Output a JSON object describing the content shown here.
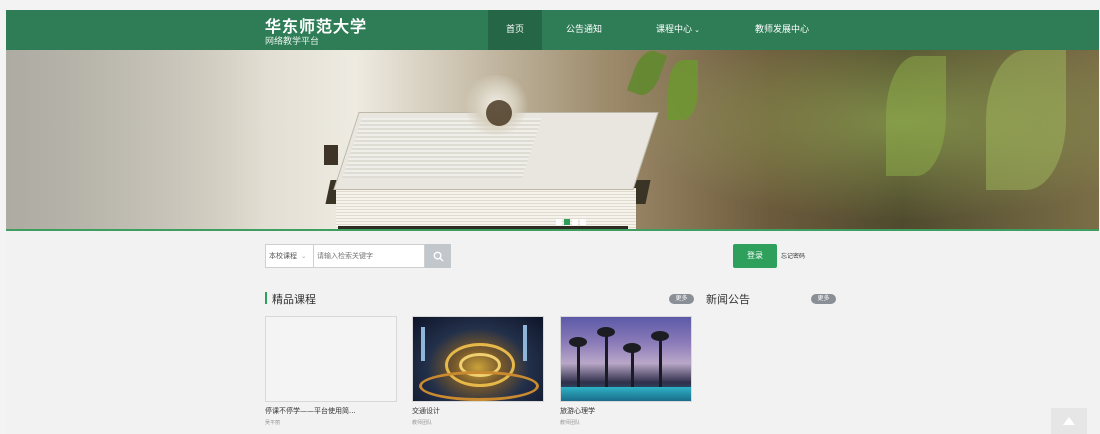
{
  "brand": {
    "title": "华东师范大学",
    "subtitle": "网络教学平台"
  },
  "nav": {
    "items": [
      {
        "label": "首页"
      },
      {
        "label": "公告通知"
      },
      {
        "label": "课程中心"
      },
      {
        "label": "教师发展中心"
      }
    ]
  },
  "search": {
    "scope": "本校课程",
    "placeholder": "请输入检索关键字"
  },
  "login": {
    "button": "登录",
    "forgot": "忘记密码"
  },
  "courses": {
    "title": "精品课程",
    "more": "更多",
    "items": [
      {
        "title": "停课不停学——平台使用简...",
        "author": "吴平丽"
      },
      {
        "title": "交通设计",
        "author": "教师团队"
      },
      {
        "title": "旅游心理学",
        "author": "教师团队"
      }
    ]
  },
  "news": {
    "title": "新闻公告",
    "more": "更多"
  },
  "colors": {
    "header": "#2f7d57",
    "accent": "#2fa05c",
    "badge": "#8a8f96"
  },
  "icons": {
    "search": "search-icon",
    "dropdown": "chevron-down-icon",
    "scroll_top": "arrow-up-icon"
  }
}
